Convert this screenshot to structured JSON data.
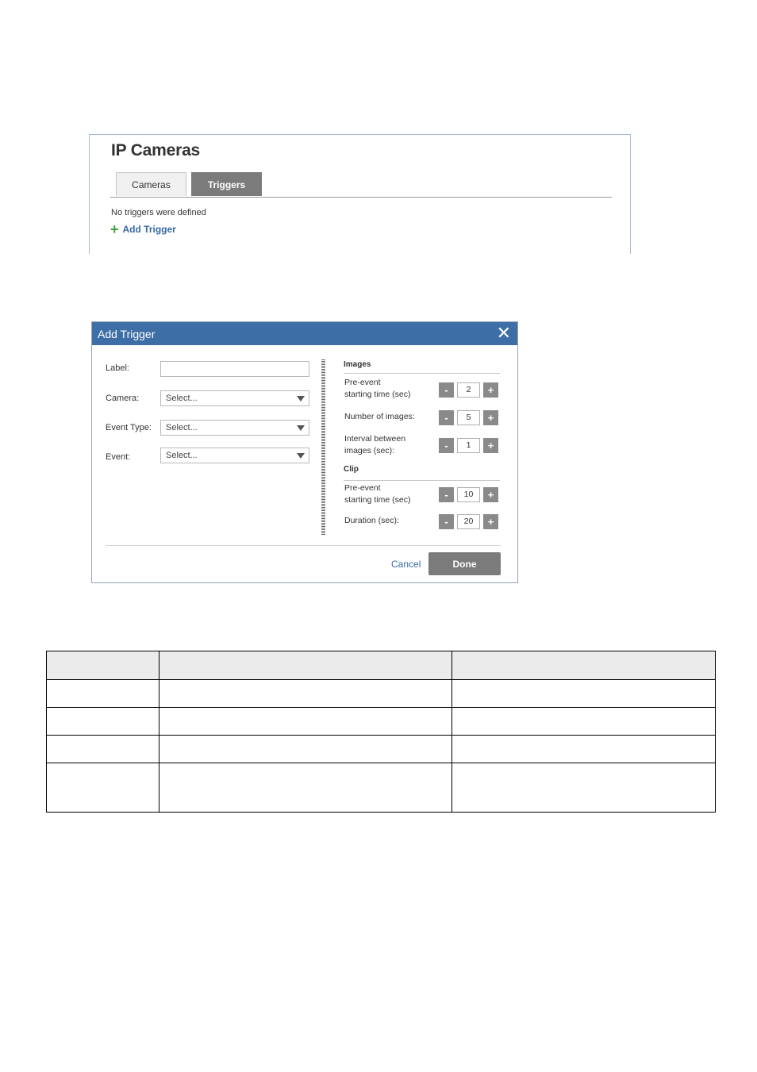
{
  "ip_cameras": {
    "title": "IP Cameras",
    "tabs": [
      {
        "label": "Cameras",
        "active": false
      },
      {
        "label": "Triggers",
        "active": true
      }
    ],
    "empty_message": "No triggers were defined",
    "add_trigger_label": "Add Trigger"
  },
  "dialog": {
    "title": "Add Trigger",
    "fields": {
      "label": {
        "label": "Label:",
        "value": ""
      },
      "camera": {
        "label": "Camera:",
        "value": "Select..."
      },
      "event_type": {
        "label": "Event Type:",
        "value": "Select..."
      },
      "event": {
        "label": "Event:",
        "value": "Select..."
      }
    },
    "images_section": "Images",
    "images": {
      "pre_event_line1": "Pre-event",
      "pre_event_line2": "starting time (sec)",
      "pre_event_value": "2",
      "number_label": "Number of images:",
      "number_value": "5",
      "interval_line1": "Interval between",
      "interval_line2": "images (sec):",
      "interval_value": "1"
    },
    "clip_section": "Clip",
    "clip": {
      "pre_event_line1": "Pre-event",
      "pre_event_line2": "starting time (sec)",
      "pre_event_value": "10",
      "duration_label": "Duration (sec):",
      "duration_value": "20"
    },
    "minus": "-",
    "plus": "+",
    "cancel": "Cancel",
    "done": "Done"
  },
  "colors": {
    "dialog_header": "#3d6ea6",
    "active_tab": "#7b7b7b",
    "link": "#3569a5",
    "add_icon": "#3aa33a"
  },
  "icons": {
    "add": "plus-icon",
    "close": "close-icon",
    "dropdown": "chevron-down-icon"
  }
}
